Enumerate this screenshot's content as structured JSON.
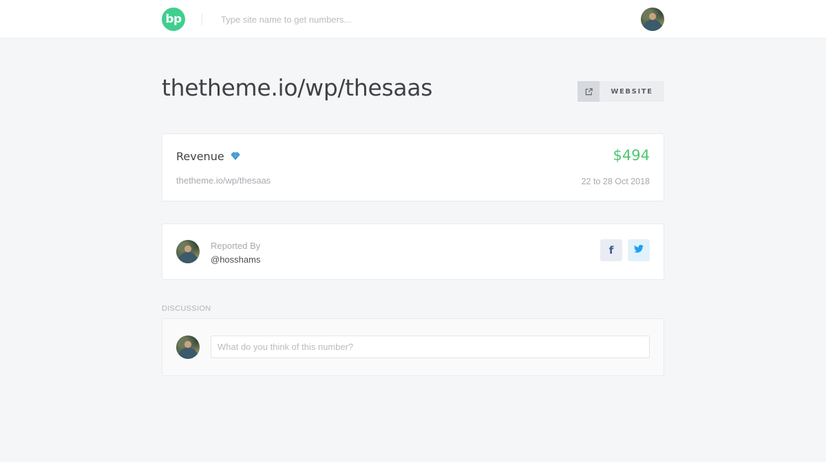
{
  "header": {
    "logo_text": "bp",
    "search_placeholder": "Type site name to get numbers...",
    "avatar_icon": "user-avatar"
  },
  "page": {
    "title": "thetheme.io/wp/thesaas",
    "website_button_label": "WEBSITE",
    "website_button_icon": "external-link-icon"
  },
  "revenue": {
    "label": "Revenue",
    "badge_icon": "diamond-icon",
    "value": "$494",
    "site": "thetheme.io/wp/thesaas",
    "date_range": "22 to 28 Oct 2018"
  },
  "reporter": {
    "reported_by_label": "Reported By",
    "handle": "@hosshams",
    "share": [
      {
        "network": "facebook",
        "glyph": "f"
      },
      {
        "network": "twitter",
        "glyph": "twitter-bird-icon"
      }
    ]
  },
  "discussion": {
    "heading": "DISCUSSION",
    "comment_placeholder": "What do you think of this number?"
  },
  "colors": {
    "brand_green": "#3fcf8e",
    "revenue_green": "#4cc76e",
    "facebook_blue": "#3b5998",
    "twitter_blue": "#1da1f2",
    "background": "#f5f6f8"
  }
}
